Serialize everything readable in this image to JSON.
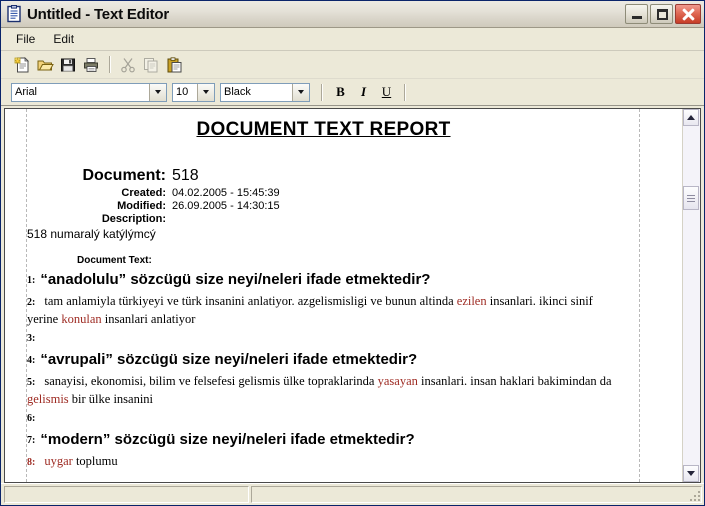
{
  "window": {
    "title": "Untitled - Text Editor",
    "icon": "document-clipboard-icon",
    "minimize_label": "Minimize",
    "maximize_label": "Maximize",
    "close_label": "Close"
  },
  "menubar": {
    "items": [
      {
        "label": "File",
        "name": "menu-file"
      },
      {
        "label": "Edit",
        "name": "menu-edit"
      }
    ]
  },
  "toolbar": {
    "buttons": [
      {
        "name": "new-document-icon",
        "tooltip": "New"
      },
      {
        "name": "open-folder-icon",
        "tooltip": "Open"
      },
      {
        "name": "save-floppy-icon",
        "tooltip": "Save"
      },
      {
        "name": "print-icon",
        "tooltip": "Print"
      },
      {
        "name": "cut-scissors-icon",
        "tooltip": "Cut",
        "disabled": true
      },
      {
        "name": "copy-icon",
        "tooltip": "Copy",
        "disabled": true
      },
      {
        "name": "paste-clipboard-icon",
        "tooltip": "Paste"
      }
    ]
  },
  "format_toolbar": {
    "font_family": {
      "value": "Arial",
      "name": "font-family-select"
    },
    "font_size": {
      "value": "10",
      "name": "font-size-select"
    },
    "font_color": {
      "value": "Black",
      "name": "font-color-select"
    },
    "bold_label": "B",
    "italic_label": "I",
    "underline_label": "U"
  },
  "document": {
    "report_title": "DOCUMENT TEXT REPORT",
    "fields": [
      {
        "label": "Document:",
        "value": "518"
      },
      {
        "label": "Created:",
        "value": "04.02.2005 - 15:45:39"
      },
      {
        "label": "Modified:",
        "value": "26.09.2005 - 14:30:15"
      },
      {
        "label": "Description:",
        "value": ""
      }
    ],
    "description_text": "518 numaralý katýlýmcý",
    "document_text_label": "Document Text:",
    "lines": [
      {
        "num": "1:",
        "kind": "question",
        "num_red": false,
        "segments": [
          {
            "text": "“anadolulu” sözcügü size neyi/neleri ifade etmektedir?",
            "red": false
          }
        ]
      },
      {
        "num": "2:",
        "kind": "answer",
        "num_red": false,
        "segments": [
          {
            "text": "tam anlamiyla türkiyeyi ve türk insanini anlatiyor. azgelismisligi ve bunun altinda ",
            "red": false
          },
          {
            "text": "ezilen",
            "red": true
          },
          {
            "text": " insanlari. ikinci sinif yerine ",
            "red": false
          },
          {
            "text": "konulan",
            "red": true
          },
          {
            "text": " insanlari anlatiyor",
            "red": false
          }
        ]
      },
      {
        "num": "3:",
        "kind": "empty",
        "num_red": false,
        "segments": []
      },
      {
        "num": "4:",
        "kind": "question",
        "num_red": false,
        "segments": [
          {
            "text": "“avrupali” sözcügü size neyi/neleri ifade etmektedir?",
            "red": false
          }
        ]
      },
      {
        "num": "5:",
        "kind": "answer",
        "num_red": false,
        "segments": [
          {
            "text": "sanayisi, ekonomisi, bilim ve felsefesi gelismis ülke topraklarinda ",
            "red": false
          },
          {
            "text": "yasayan",
            "red": true
          },
          {
            "text": " insanlari. insan haklari bakimindan da ",
            "red": false
          },
          {
            "text": "gelismis",
            "red": true
          },
          {
            "text": " bir ülke insanini",
            "red": false
          }
        ]
      },
      {
        "num": "6:",
        "kind": "empty",
        "num_red": false,
        "segments": []
      },
      {
        "num": "7:",
        "kind": "question",
        "num_red": false,
        "segments": [
          {
            "text": "“modern” sözcügü size neyi/neleri ifade etmektedir?",
            "red": false
          }
        ]
      },
      {
        "num": "8:",
        "kind": "answer",
        "num_red": true,
        "segments": [
          {
            "text": "uygar",
            "red": true
          },
          {
            "text": " toplumu",
            "red": false
          }
        ]
      }
    ]
  },
  "scrollbar": {
    "name": "vertical-scrollbar",
    "up_arrow": "scroll-up-arrow-icon",
    "down_arrow": "scroll-down-arrow-icon",
    "thumb_top_pct": 19
  },
  "statusbar": {
    "left_text": "",
    "right_text": ""
  },
  "colors": {
    "highlight_red": "#9e2b23",
    "window_face": "#ece9d8",
    "titlebar_top": "#eceae3",
    "titlebar_bottom": "#cfcabc",
    "close_button": "#c63c26"
  }
}
